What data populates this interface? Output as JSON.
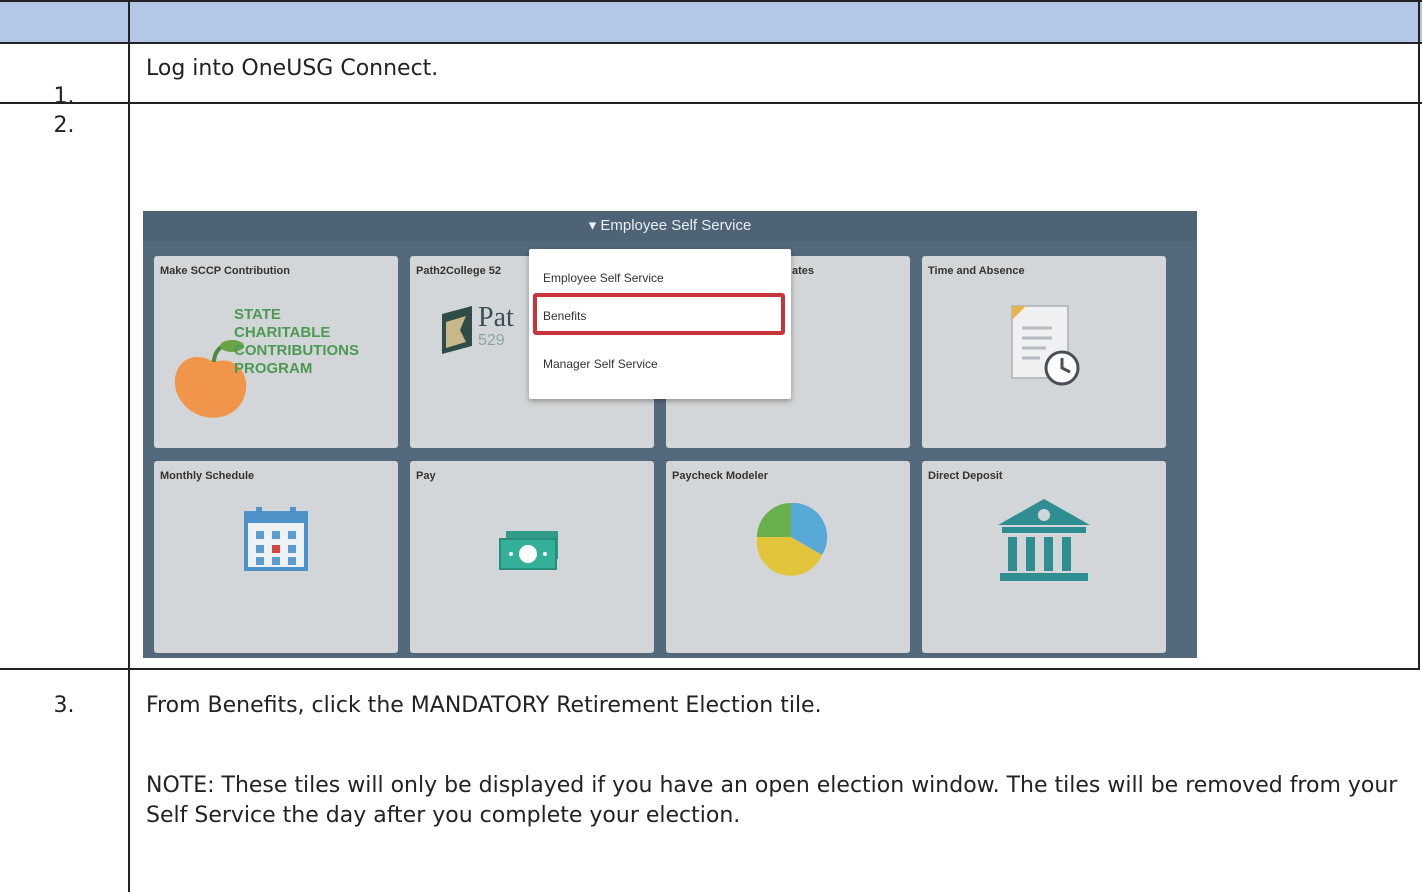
{
  "steps": [
    {
      "number": "1.",
      "text": "Log into OneUSG Connect."
    },
    {
      "number": "2.",
      "text": ""
    },
    {
      "number": "3.",
      "text": "From Benefits, click the MANDATORY Retirement Election tile.",
      "note": "NOTE: These tiles will only be displayed if you have an open election window. The tiles will be removed from your Self Service the day after you complete your election."
    }
  ],
  "screenshot": {
    "header_title": "▾ Employee Self Service",
    "menu": {
      "items": [
        "Employee Self Service",
        "Benefits",
        "Manager Self Service"
      ],
      "highlighted": "Benefits"
    },
    "tiles": [
      {
        "title": "Make SCCP Contribution",
        "icon": "peach-logo-icon"
      },
      {
        "title": "Path2College 52",
        "icon": "path2college-logo-icon"
      },
      {
        "title": "ates",
        "icon": "star-badge-icon"
      },
      {
        "title": "Time and Absence",
        "icon": "document-clock-icon"
      },
      {
        "title": "Monthly Schedule",
        "icon": "calendar-icon"
      },
      {
        "title": "Pay",
        "icon": "money-icon"
      },
      {
        "title": "Paycheck Modeler",
        "icon": "pie-chart-icon"
      },
      {
        "title": "Direct Deposit",
        "icon": "bank-icon"
      }
    ],
    "sccp_logo_text": [
      "STATE",
      "CHARITABLE",
      "CONTRIBUTIONS",
      "PROGRAM"
    ],
    "path_logo_text": "Pat",
    "path_logo_sub": "529"
  },
  "colors": {
    "header_fill": "#b4c7e7",
    "highlight_border": "#c9343a",
    "screenshot_bg": "#55697c"
  }
}
